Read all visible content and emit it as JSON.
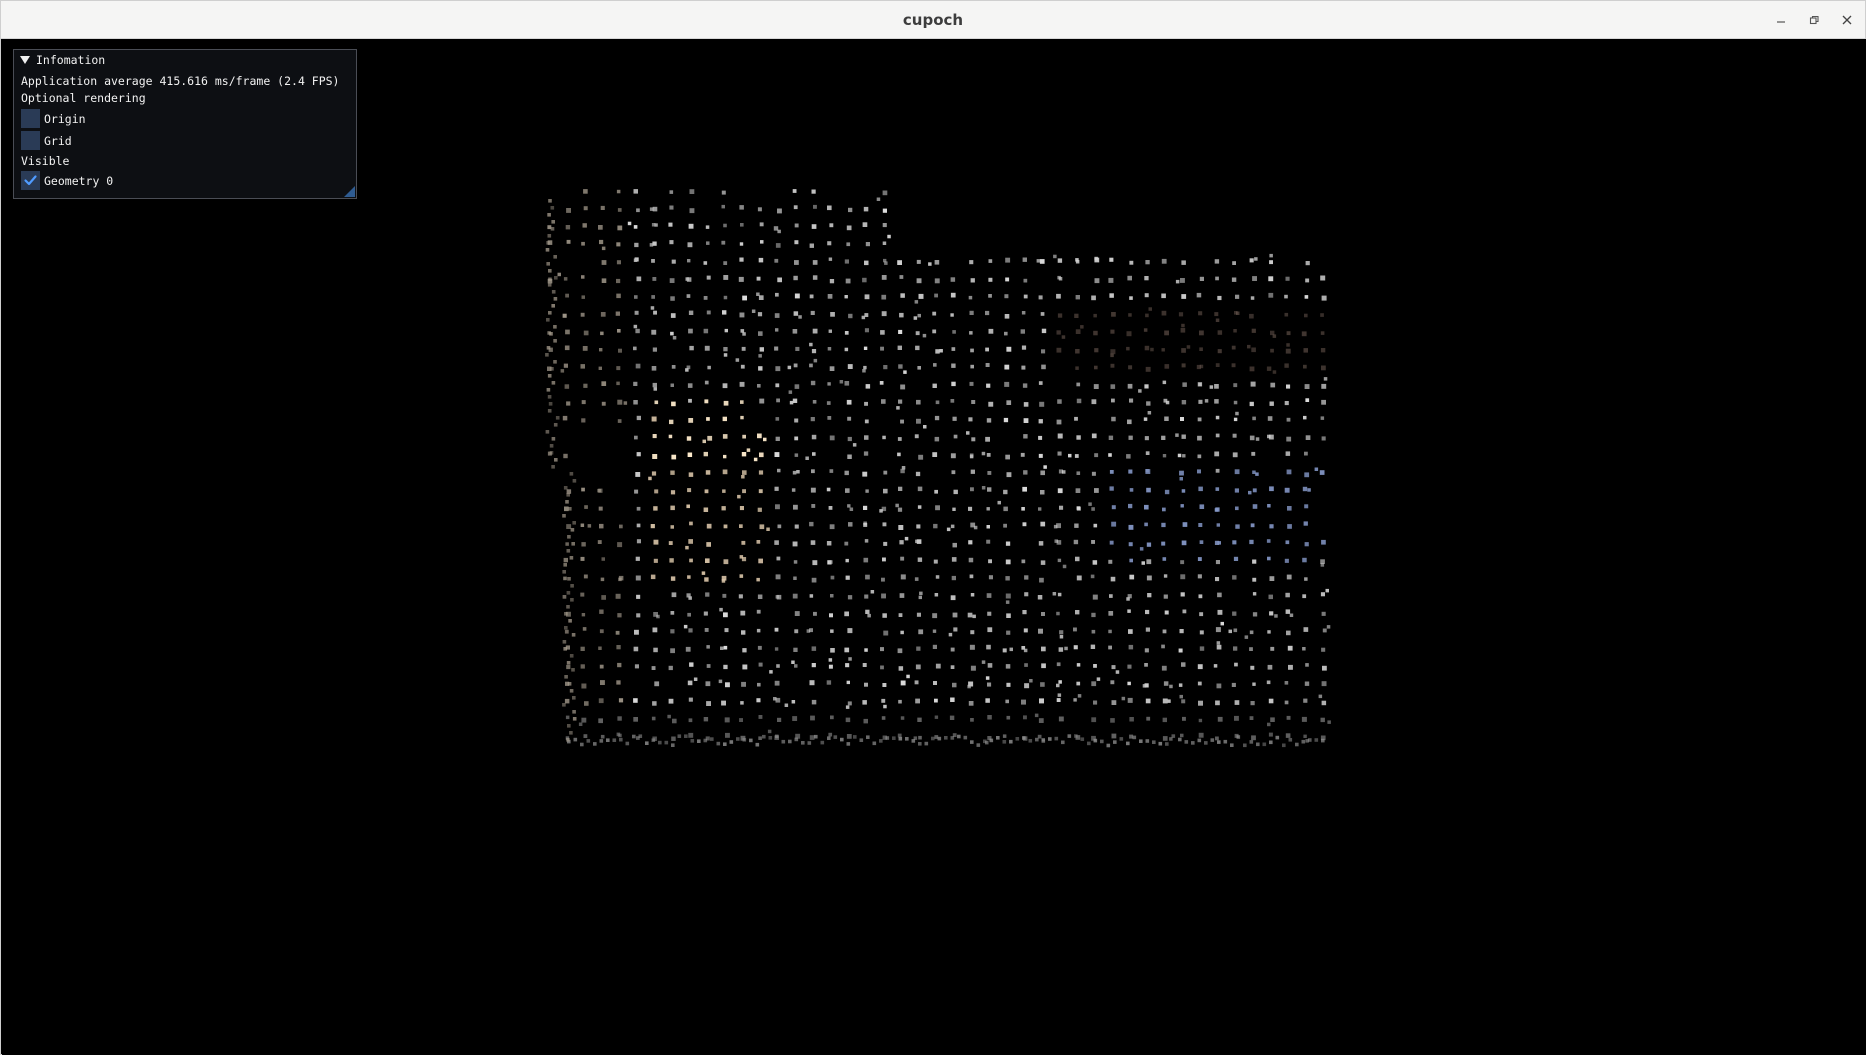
{
  "window": {
    "title": "cupoch",
    "controls": [
      "minimize-icon",
      "restore-icon",
      "close-icon"
    ]
  },
  "panel": {
    "header": "Infomation",
    "stats": "Application average 415.616 ms/frame (2.4 FPS)",
    "optional_label": "Optional rendering",
    "options": [
      {
        "label": "Origin",
        "checked": false
      },
      {
        "label": "Grid",
        "checked": false
      }
    ],
    "visible_label": "Visible",
    "geometries": [
      {
        "label": "Geometry 0",
        "checked": true
      }
    ]
  },
  "colors": {
    "titlebar_bg": "#f5f5f4",
    "viewport_bg": "#000000",
    "panel_bg": "#0e1014",
    "checkbox_bg": "#2a3b56",
    "checkmark": "#4f9bff",
    "resize_grip": "#2f5c92"
  }
}
